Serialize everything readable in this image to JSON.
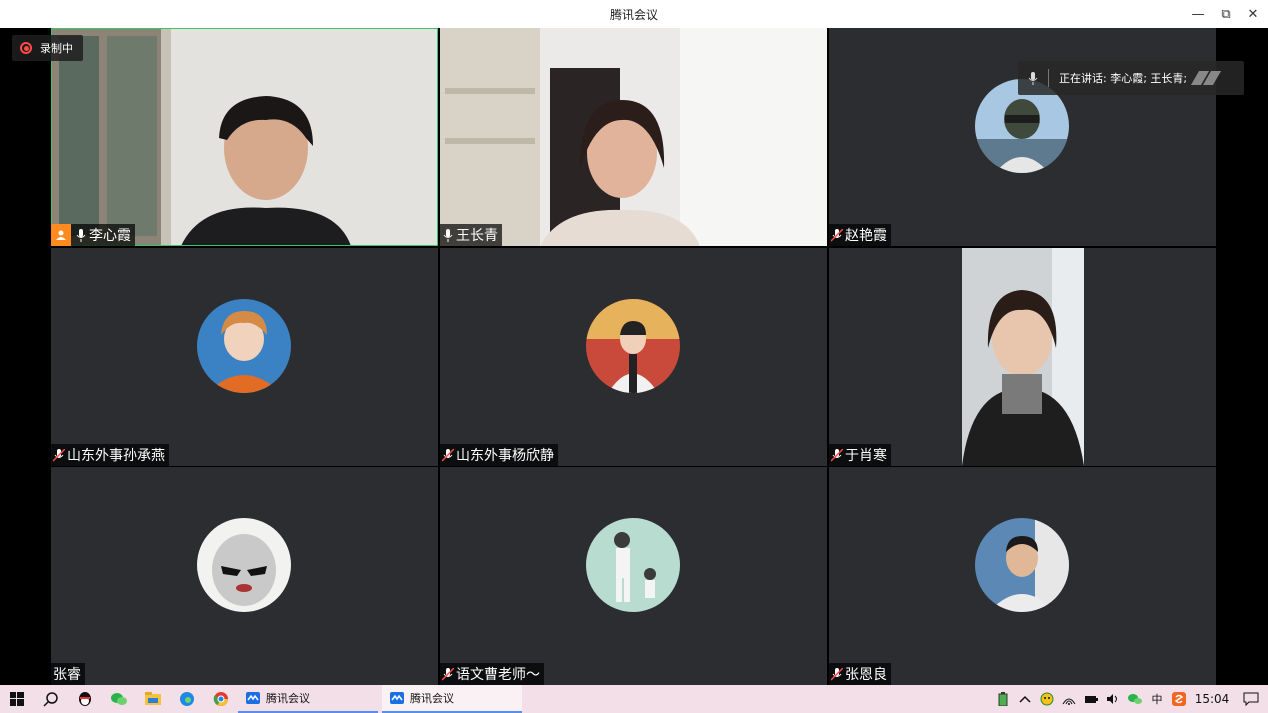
{
  "window": {
    "title": "腾讯会议",
    "minimize": "—",
    "restore": "⧉",
    "close": "✕"
  },
  "recording": {
    "label": "录制中"
  },
  "speaking": {
    "label": "正在讲话: 李心霞; 王长青;"
  },
  "participants": [
    {
      "name": "李心霞",
      "host": true,
      "video": true,
      "active": true
    },
    {
      "name": "王长青",
      "host": false,
      "video": true,
      "active": false
    },
    {
      "name": "赵艳霞",
      "host": false,
      "video": false,
      "muted": true
    },
    {
      "name": "山东外事孙承燕",
      "host": false,
      "video": false,
      "muted": true
    },
    {
      "name": "山东外事杨欣静",
      "host": false,
      "video": false,
      "muted": true
    },
    {
      "name": "于肖寒",
      "host": false,
      "video": true,
      "muted": true
    },
    {
      "name": "张睿",
      "host": false,
      "video": false,
      "muted": false,
      "no_mic": true
    },
    {
      "name": "语文曹老师～",
      "host": false,
      "video": false,
      "muted": true
    },
    {
      "name": "张恩良",
      "host": false,
      "video": false,
      "muted": true
    }
  ],
  "taskbar": {
    "apps": [
      {
        "label": "腾讯会议"
      },
      {
        "label": "腾讯会议"
      }
    ],
    "ime": "中",
    "clock": "15:04"
  },
  "colors": {
    "tile_bg": "#2b2d30",
    "active_border": "#3ec46d",
    "host_badge": "#ff8a1f",
    "taskbar_bg": "#f3dfe8"
  }
}
